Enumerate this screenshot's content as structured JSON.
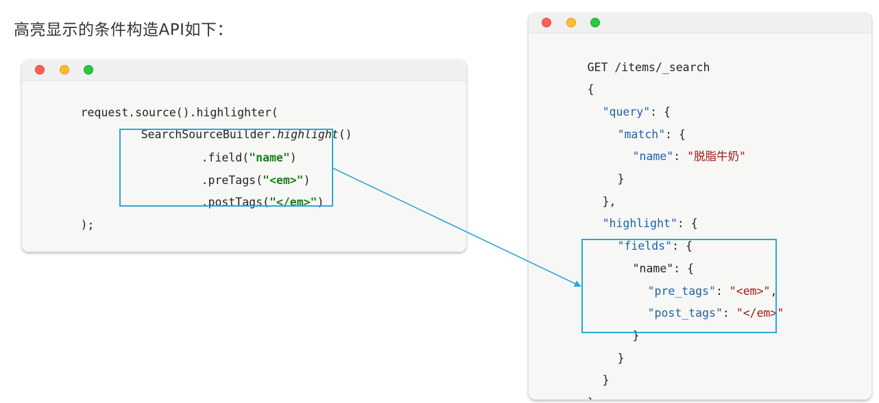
{
  "heading": "高亮显示的条件构造API如下：",
  "java_window": {
    "lines": {
      "l1": "request.source().highlighter(",
      "l2_plain": "SearchSourceBuilder.",
      "l2_italic": "highlight",
      "l2_end": "()",
      "l3_pre": ".field(",
      "l3_str": "\"name\"",
      "l3_end": ")",
      "l4_pre": ".preTags(",
      "l4_str": "\"<em>\"",
      "l4_end": ")",
      "l5_pre": ".postTags(",
      "l5_str": "\"</em>\"",
      "l5_end": ")",
      "l6": ");"
    }
  },
  "json_window": {
    "lines": {
      "l1": "GET /items/_search",
      "l2": "{",
      "l3_key": "\"query\"",
      "l3_rest": ": {",
      "l4_key": "\"match\"",
      "l4_rest": ": {",
      "l5_key": "\"name\"",
      "l5_sep": ": ",
      "l5_val": "\"脱脂牛奶\"",
      "l6": "}",
      "l7": "},",
      "l8_key": "\"highlight\"",
      "l8_rest": ": {",
      "l9_key": "\"fields\"",
      "l9_rest": ": {",
      "l10_key": "\"name\"",
      "l10_rest": ": {",
      "l11_key": "\"pre_tags\"",
      "l11_sep": ": ",
      "l11_val": "\"<em>\"",
      "l11_end": ",",
      "l12_key": "\"post_tags\"",
      "l12_sep": ": ",
      "l12_val": "\"</em>\"",
      "l13": "}",
      "l14": "}",
      "l15": "}",
      "l16": "}"
    }
  },
  "colors": {
    "highlight_box": "#2aa6dc",
    "string_green": "#1a7c1a",
    "json_key": "#1f5fa8",
    "json_string": "#a31515"
  }
}
